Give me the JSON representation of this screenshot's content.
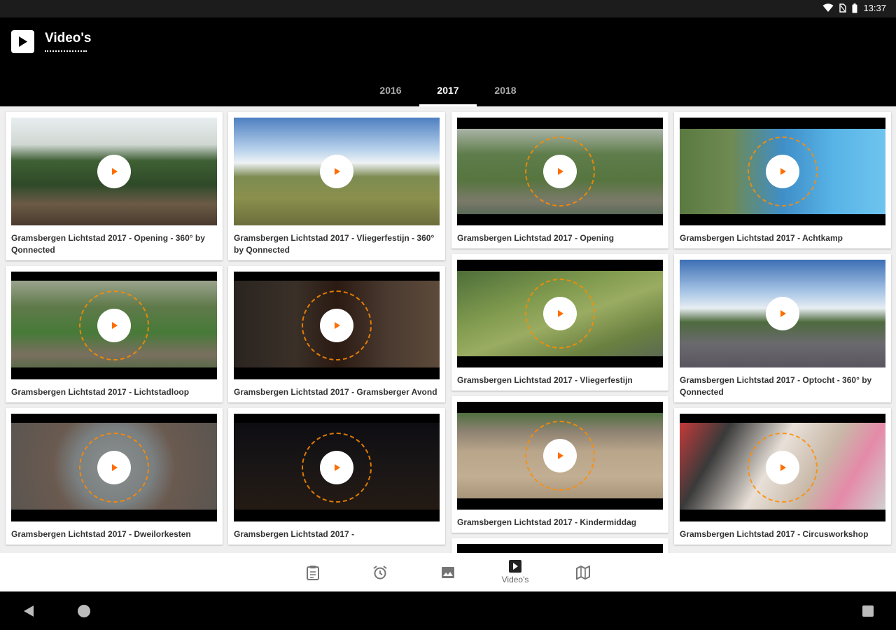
{
  "status_bar": {
    "time": "13:37"
  },
  "app_bar": {
    "title": "Video's"
  },
  "tabs": [
    {
      "label": "2016",
      "active": false
    },
    {
      "label": "2017",
      "active": true
    },
    {
      "label": "2018",
      "active": false
    }
  ],
  "videos": [
    {
      "title": "Gramsbergen Lichtstad 2017 - Opening - 360° by Qonnected"
    },
    {
      "title": "Gramsbergen Lichtstad 2017 - Lichtstadloop"
    },
    {
      "title": "Gramsbergen Lichtstad 2017 - Dweilorkesten"
    },
    {
      "title": "Gramsbergen Lichtstad 2017 - Vliegerfestijn - 360° by Qonnected"
    },
    {
      "title": "Gramsbergen Lichtstad 2017 - Gramsberger Avond"
    },
    {
      "title": "Gramsbergen Lichtstad 2017 -"
    },
    {
      "title": "Gramsbergen Lichtstad 2017 - Opening"
    },
    {
      "title": "Gramsbergen Lichtstad 2017 - Vliegerfestijn"
    },
    {
      "title": "Gramsbergen Lichtstad 2017 - Kindermiddag"
    },
    {
      "title": "Gramsbergen Lichtstad 2017 - Achtkamp"
    },
    {
      "title": "Gramsbergen Lichtstad 2017 - Optocht - 360° by Qonnected"
    },
    {
      "title": "Gramsbergen Lichtstad 2017 - Circusworkshop"
    }
  ],
  "bottom_nav": {
    "items": [
      {
        "icon": "clipboard-icon",
        "label": ""
      },
      {
        "icon": "alarm-clock-icon",
        "label": ""
      },
      {
        "icon": "image-icon",
        "label": ""
      },
      {
        "icon": "video-icon",
        "label": "Video's",
        "active": true
      },
      {
        "icon": "map-icon",
        "label": ""
      }
    ]
  },
  "colors": {
    "accent": "#ff6d00",
    "app_bar": "#000000",
    "background": "#efefef"
  }
}
